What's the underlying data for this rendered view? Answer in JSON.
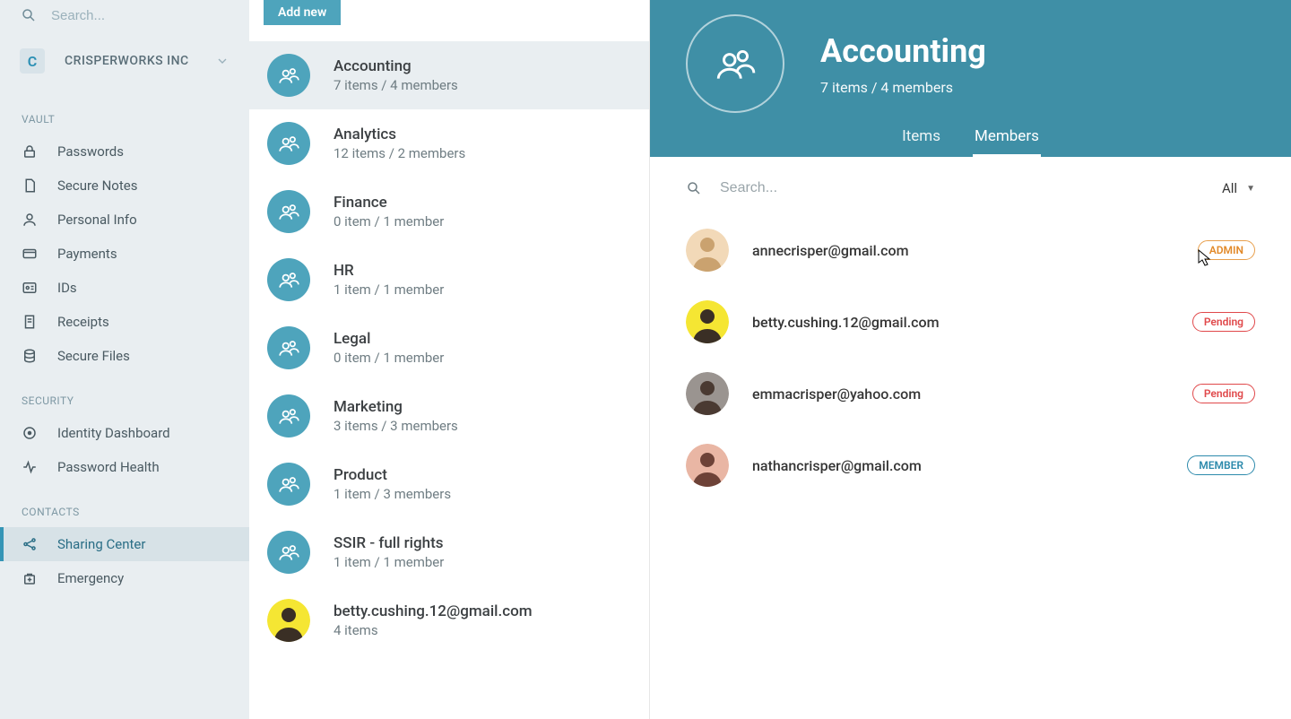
{
  "search_placeholder": "Search...",
  "org": {
    "initial": "C",
    "name": "CRISPERWORKS INC"
  },
  "sections": {
    "vault": {
      "label": "VAULT",
      "items": [
        "Passwords",
        "Secure Notes",
        "Personal Info",
        "Payments",
        "IDs",
        "Receipts",
        "Secure Files"
      ]
    },
    "security": {
      "label": "SECURITY",
      "items": [
        "Identity Dashboard",
        "Password Health"
      ]
    },
    "contacts": {
      "label": "CONTACTS",
      "items": [
        "Sharing Center",
        "Emergency"
      ]
    }
  },
  "add_new_label": "Add new",
  "groups": [
    {
      "name": "Accounting",
      "sub": "7 items / 4 members"
    },
    {
      "name": "Analytics",
      "sub": "12 items / 2 members"
    },
    {
      "name": "Finance",
      "sub": "0 item / 1 member"
    },
    {
      "name": "HR",
      "sub": "1 item / 1 member"
    },
    {
      "name": "Legal",
      "sub": "0 item / 1 member"
    },
    {
      "name": "Marketing",
      "sub": "3 items / 3 members"
    },
    {
      "name": "Product",
      "sub": "1 item / 3 members"
    },
    {
      "name": "SSIR - full rights",
      "sub": "1 item / 1 member"
    }
  ],
  "shared_user": {
    "name": "betty.cushing.12@gmail.com",
    "sub": "4 items"
  },
  "detail": {
    "title": "Accounting",
    "sub": "7 items / 4 members",
    "tabs": {
      "items": "Items",
      "members": "Members"
    },
    "search_placeholder": "Search...",
    "filter": "All",
    "members": [
      {
        "email": "annecrisper@gmail.com",
        "badge": "ADMIN",
        "badge_type": "admin",
        "avatar_bg": "#f2d9b8",
        "avatar_fg": "#caa26f"
      },
      {
        "email": "betty.cushing.12@gmail.com",
        "badge": "Pending",
        "badge_type": "pending",
        "avatar_bg": "#f5e633",
        "avatar_fg": "#3a2f25"
      },
      {
        "email": "emmacrisper@yahoo.com",
        "badge": "Pending",
        "badge_type": "pending",
        "avatar_bg": "#9a9490",
        "avatar_fg": "#4a3a32"
      },
      {
        "email": "nathancrisper@gmail.com",
        "badge": "MEMBER",
        "badge_type": "member",
        "avatar_bg": "#e9b6a4",
        "avatar_fg": "#6d4237"
      }
    ]
  }
}
